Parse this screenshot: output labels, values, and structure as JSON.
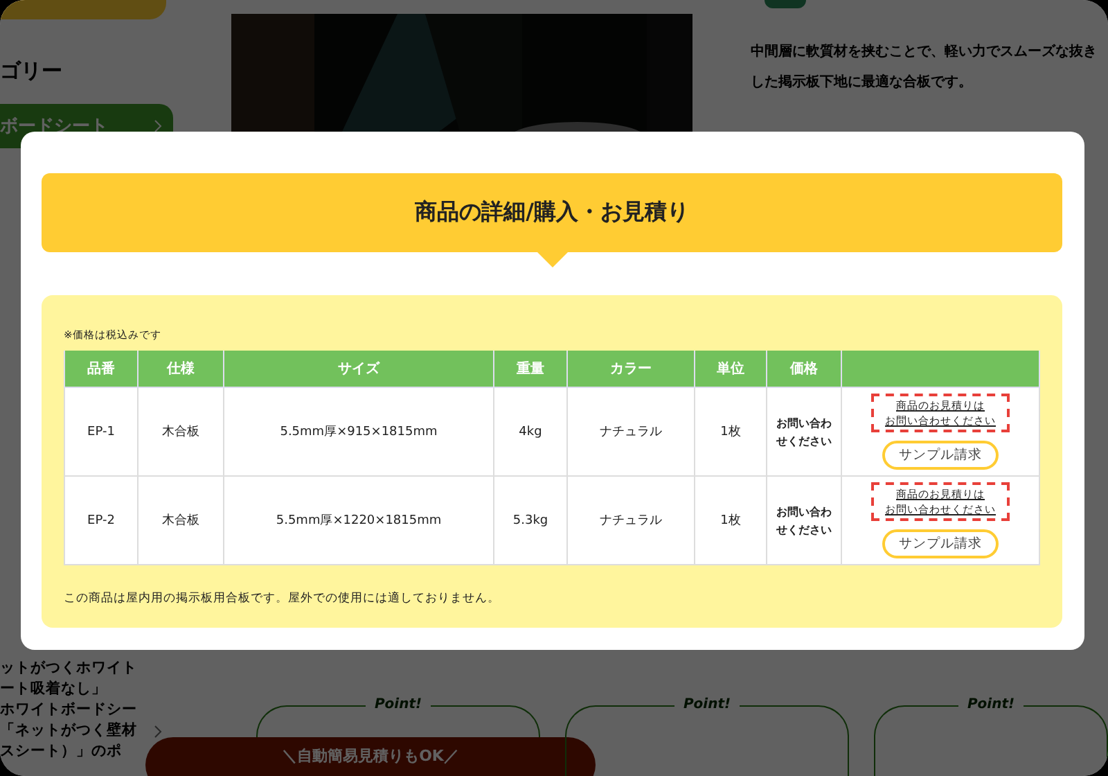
{
  "background": {
    "sidebar_heading": "ゴリー",
    "sidebar_active": "ボードシート",
    "sidebar_items": [
      "ットがつくホワイト",
      "ート吸着なし」",
      "ホワイトボードシー",
      "「ネットがつく壁材",
      "スシート）」のポ"
    ],
    "description": [
      "中間層に軟質材を挟むことで、軽い力でスムーズな抜き",
      "した掲示板下地に最適な合板です。"
    ],
    "points": [
      "Point!",
      "Point!",
      "Point!"
    ],
    "banner": "＼自動簡易見積りもOK／"
  },
  "modal": {
    "title": "商品の詳細/購入・お見積り",
    "tax_note": "※価格は税込みです",
    "table": {
      "columns": [
        "品番",
        "仕様",
        "サイズ",
        "重量",
        "カラー",
        "単位",
        "価格"
      ],
      "rows": [
        {
          "code": "EP-1",
          "spec": "木合板",
          "size": "5.5mm厚×915×1815mm",
          "weight": "4kg",
          "finish": "ナチュラル",
          "unit": "1枚",
          "price": [
            "お問い合わ",
            "せください"
          ],
          "quote_link": [
            "商品のお見積りは",
            "お問い合わせください"
          ],
          "sample_button": "サンプル請求"
        },
        {
          "code": "EP-2",
          "spec": "木合板",
          "size": "5.5mm厚×1220×1815mm",
          "weight": "5.3kg",
          "finish": "ナチュラル",
          "unit": "1枚",
          "price": [
            "お問い合わ",
            "せください"
          ],
          "quote_link": [
            "商品のお見積りは",
            "お問い合わせください"
          ],
          "sample_button": "サンプル請求"
        }
      ]
    },
    "footer_note": "この商品は屋内用の掲示板用合板です。屋外での使用には適しておりません。"
  }
}
